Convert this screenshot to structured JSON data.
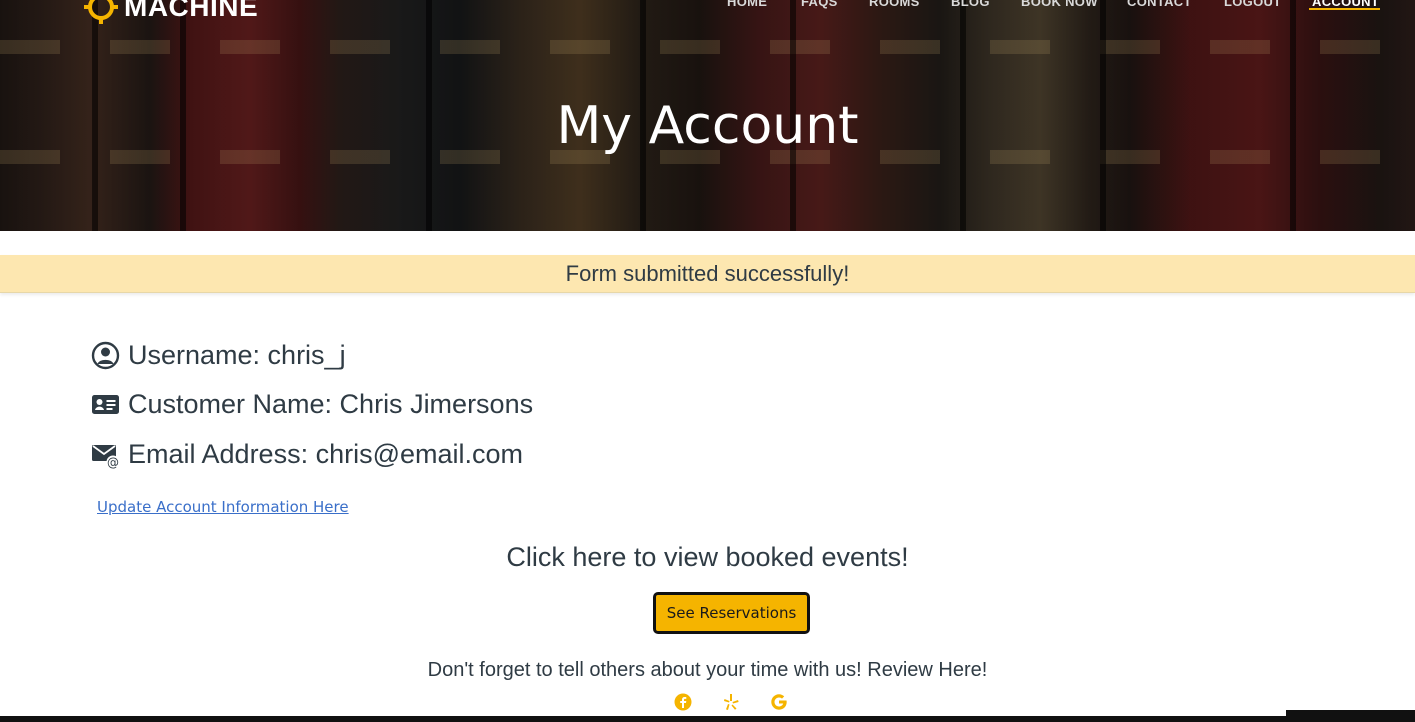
{
  "brand": {
    "logo_text": "MACHINE",
    "accent_color": "#f5b400"
  },
  "nav": {
    "items": [
      {
        "label": "HOME"
      },
      {
        "label": "FAQS"
      },
      {
        "label": "ROOMS"
      },
      {
        "label": "BLOG"
      },
      {
        "label": "BOOK NOW"
      },
      {
        "label": "CONTACT"
      },
      {
        "label": "LOGOUT"
      },
      {
        "label": "ACCOUNT"
      }
    ],
    "active": "ACCOUNT"
  },
  "hero": {
    "title": "My Account"
  },
  "alert": {
    "message": "Form submitted successfully!",
    "background": "#fde7b0"
  },
  "account": {
    "username": {
      "label": "Username: chris_j",
      "icon": "user-circle-icon"
    },
    "customer_name": {
      "label": "Customer Name: Chris Jimersons",
      "icon": "id-card-icon"
    },
    "email": {
      "label": "Email Address: chris@email.com",
      "icon": "envelope-at-icon"
    },
    "update_link": "Update Account Information Here"
  },
  "booked": {
    "heading": "Click here to view booked events!",
    "button_label": "See Reservations"
  },
  "review": {
    "text": "Don't forget to tell others about your time with us! Review Here!",
    "icons": [
      "facebook-icon",
      "yelp-icon",
      "google-icon"
    ]
  }
}
